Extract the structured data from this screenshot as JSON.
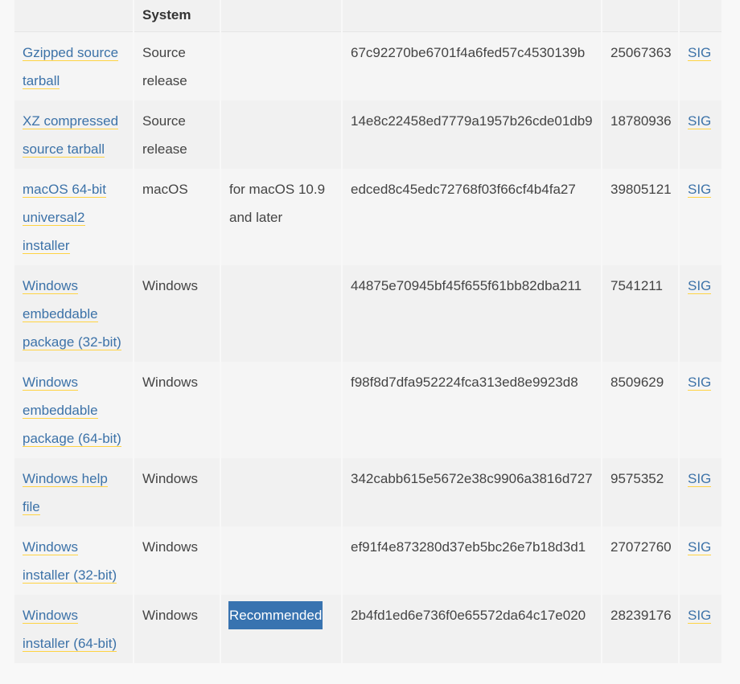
{
  "table": {
    "header": [
      "",
      "System",
      "",
      "",
      "",
      ""
    ],
    "rows": [
      {
        "file": "Gzipped source tarball",
        "os": "Source release",
        "description": "",
        "md5": "67c92270be6701f4a6fed57c4530139b",
        "size": "25067363",
        "sig": "SIG",
        "badge": ""
      },
      {
        "file": "XZ compressed source tarball",
        "os": "Source release",
        "description": "",
        "md5": "14e8c22458ed7779a1957b26cde01db9",
        "size": "18780936",
        "sig": "SIG",
        "badge": ""
      },
      {
        "file": "macOS 64-bit universal2 installer",
        "os": "macOS",
        "description": "for macOS 10.9 and later",
        "md5": "edced8c45edc72768f03f66cf4b4fa27",
        "size": "39805121",
        "sig": "SIG",
        "badge": ""
      },
      {
        "file": "Windows embeddable package (32-bit)",
        "os": "Windows",
        "description": "",
        "md5": "44875e70945bf45f655f61bb82dba211",
        "size": "7541211",
        "sig": "SIG",
        "badge": ""
      },
      {
        "file": "Windows embeddable package (64-bit)",
        "os": "Windows",
        "description": "",
        "md5": "f98f8d7dfa952224fca313ed8e9923d8",
        "size": "8509629",
        "sig": "SIG",
        "badge": ""
      },
      {
        "file": "Windows help file",
        "os": "Windows",
        "description": "",
        "md5": "342cabb615e5672e38c9906a3816d727",
        "size": "9575352",
        "sig": "SIG",
        "badge": ""
      },
      {
        "file": "Windows installer (32-bit)",
        "os": "Windows",
        "description": "",
        "md5": "ef91f4e873280d37eb5bc26e7b18d3d1",
        "size": "27072760",
        "sig": "SIG",
        "badge": ""
      },
      {
        "file": "Windows installer (64-bit)",
        "os": "Windows",
        "description": "",
        "md5": "2b4fd1ed6e736f0e65572da64c17e020",
        "size": "28239176",
        "sig": "SIG",
        "badge": "Recommended"
      }
    ]
  },
  "colors": {
    "link": "#3c72a8",
    "link_underline": "#ffd343",
    "badge_bg": "#3873b0",
    "row_odd": "#f5f5f5",
    "row_even": "#f1f1f1",
    "page_bg": "#f8f8f8"
  }
}
